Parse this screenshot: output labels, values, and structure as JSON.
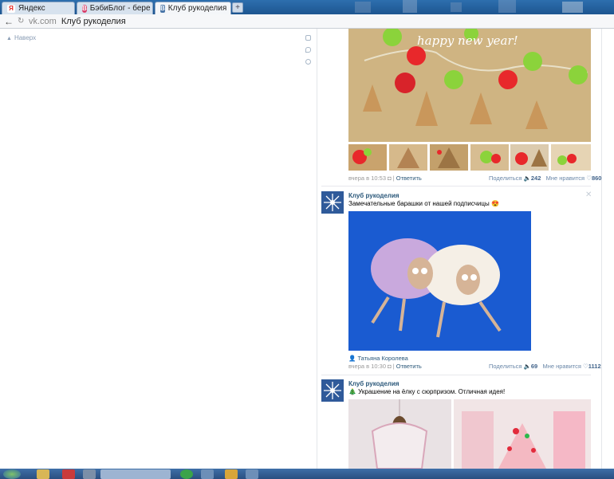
{
  "browser": {
    "tabs": [
      {
        "label": "Яндекс",
        "favicon": "Я",
        "color": "#e52620"
      },
      {
        "label": "БэбиБлог - бере",
        "favicon": "B",
        "color": "#d8406a"
      },
      {
        "label": "Клуб рукоделия",
        "favicon": "В",
        "color": "#4a76a8"
      }
    ],
    "new_tab": "+",
    "close": "×",
    "address": {
      "domain": "vk.com",
      "title": "Клуб рукоделия"
    }
  },
  "page": {
    "up_link": "Наверх",
    "posts": [
      {
        "time": "вчера в 10:53",
        "reply": "Ответить",
        "share_label": "Поделиться",
        "share_count": "242",
        "like_label": "Мне нравится",
        "like_count": "860",
        "image_text": "happy new year!"
      },
      {
        "group": "Клуб рукоделия",
        "text": "Замечательные барашки от нашей подписчицы 😍",
        "author": "Татьяна Королева",
        "time": "вчера в 10:30",
        "reply": "Ответить",
        "share_label": "Поделиться",
        "share_count": "69",
        "like_label": "Мне нравится",
        "like_count": "1112"
      },
      {
        "group": "Клуб рукоделия",
        "text": "🎄 Украшение на ёлку с сюрпризом. Отличная идея!"
      }
    ]
  },
  "colors": {
    "link": "#2b587a",
    "tab_bar": "#2d6fae",
    "taskbar": "#3f6fa8"
  }
}
